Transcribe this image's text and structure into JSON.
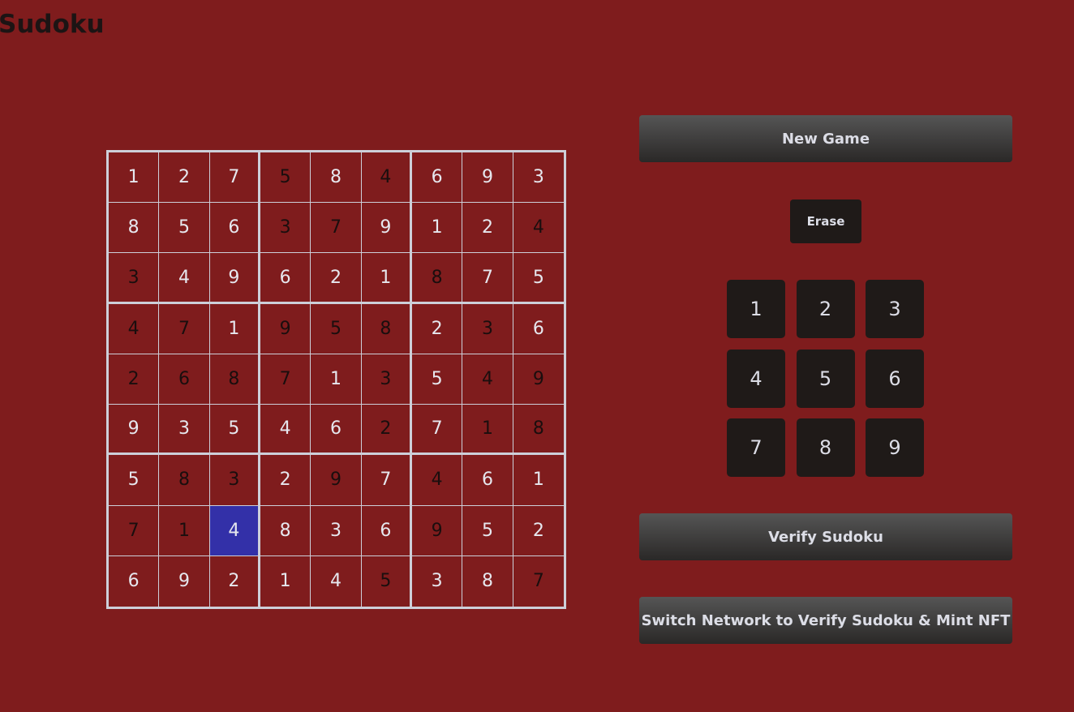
{
  "title": "Sudoku",
  "colors": {
    "background": "#7f1c1d",
    "grid_lines": "#cdcfd9",
    "selected_cell": "#3330a8",
    "given_digit": "#e6e7ee",
    "user_digit": "#1a0e0e",
    "button_dark": "#1f1a18"
  },
  "board": {
    "rows": [
      [
        "1",
        "2",
        "7",
        "5",
        "8",
        "4",
        "6",
        "9",
        "3"
      ],
      [
        "8",
        "5",
        "6",
        "3",
        "7",
        "9",
        "1",
        "2",
        "4"
      ],
      [
        "3",
        "4",
        "9",
        "6",
        "2",
        "1",
        "8",
        "7",
        "5"
      ],
      [
        "4",
        "7",
        "1",
        "9",
        "5",
        "8",
        "2",
        "3",
        "6"
      ],
      [
        "2",
        "6",
        "8",
        "7",
        "1",
        "3",
        "5",
        "4",
        "9"
      ],
      [
        "9",
        "3",
        "5",
        "4",
        "6",
        "2",
        "7",
        "1",
        "8"
      ],
      [
        "5",
        "8",
        "3",
        "2",
        "9",
        "7",
        "4",
        "6",
        "1"
      ],
      [
        "7",
        "1",
        "4",
        "8",
        "3",
        "6",
        "9",
        "5",
        "2"
      ],
      [
        "6",
        "9",
        "2",
        "1",
        "4",
        "5",
        "3",
        "8",
        "7"
      ]
    ],
    "given": [
      [
        1,
        1,
        1,
        0,
        1,
        0,
        1,
        1,
        1
      ],
      [
        1,
        1,
        1,
        0,
        0,
        1,
        1,
        1,
        0
      ],
      [
        0,
        1,
        1,
        1,
        1,
        1,
        0,
        1,
        1
      ],
      [
        0,
        0,
        1,
        0,
        0,
        0,
        1,
        0,
        1
      ],
      [
        0,
        0,
        0,
        0,
        1,
        0,
        1,
        0,
        0
      ],
      [
        1,
        1,
        1,
        1,
        1,
        0,
        1,
        0,
        0
      ],
      [
        1,
        0,
        0,
        1,
        0,
        1,
        0,
        1,
        1
      ],
      [
        0,
        0,
        1,
        1,
        1,
        1,
        0,
        1,
        1
      ],
      [
        1,
        1,
        1,
        1,
        1,
        0,
        1,
        1,
        0
      ]
    ],
    "selected": {
      "row": 7,
      "col": 2
    }
  },
  "controls": {
    "new_game_label": "New Game",
    "erase_label": "Erase",
    "numpad": [
      "1",
      "2",
      "3",
      "4",
      "5",
      "6",
      "7",
      "8",
      "9"
    ],
    "verify_label": "Verify Sudoku",
    "switch_label": "Switch Network to Verify Sudoku & Mint NFT"
  }
}
